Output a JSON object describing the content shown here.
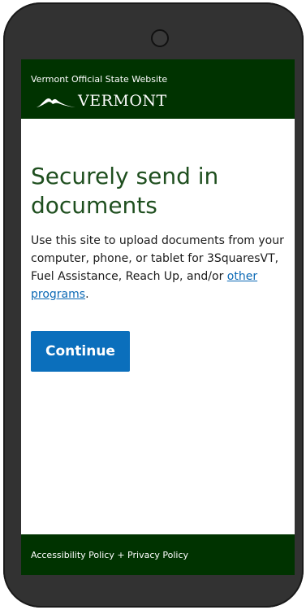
{
  "colors": {
    "header_bg": "#003300",
    "title": "#1f4f1f",
    "link": "#0b69b5",
    "button_bg": "#0b6fbc",
    "footer_bg": "#003300"
  },
  "header": {
    "tagline": "Vermont Official State Website",
    "logo_text": "VERMONT",
    "logo_icon": "mountain-icon"
  },
  "main": {
    "title": "Securely send in documents",
    "description_before": "Use this site to upload documents from your computer, phone, or tablet for 3SquaresVT, Fuel Assistance, Reach Up, and/or ",
    "description_link": "other programs",
    "description_after": ".",
    "continue_label": "Continue"
  },
  "footer": {
    "accessibility_label": "Accessibility Policy",
    "separator": "+",
    "privacy_label": "Privacy Policy"
  }
}
